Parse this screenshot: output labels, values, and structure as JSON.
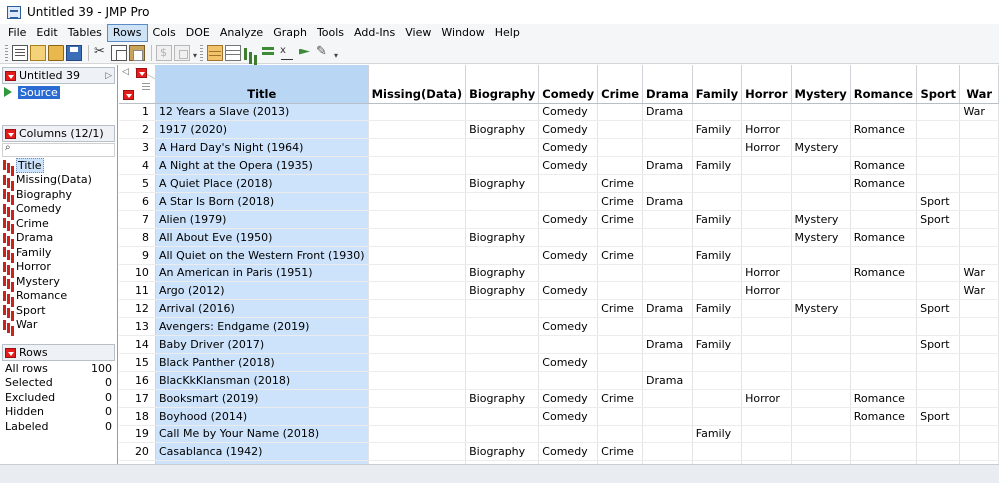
{
  "window": {
    "title": "Untitled 39 - JMP Pro"
  },
  "menu": [
    "File",
    "Edit",
    "Tables",
    "Rows",
    "Cols",
    "DOE",
    "Analyze",
    "Graph",
    "Tools",
    "Add-Ins",
    "View",
    "Window",
    "Help"
  ],
  "menu_active": "Rows",
  "toolbar_icons": [
    "new-data-table-icon",
    "new-script-icon",
    "open-icon",
    "save-icon",
    "cut-icon",
    "copy-icon",
    "paste-icon",
    "disabled-script-icon",
    "disabled-table-icon",
    "data-table-icon",
    "tabulate-icon",
    "distribution-icon",
    "graph-builder-icon",
    "fit-y-by-x-icon",
    "fit-model-icon",
    "edit-script-icon"
  ],
  "left_panel": {
    "table_name": "Untitled 39",
    "source_label": "Source",
    "columns_header": "Columns (12/1)",
    "columns": [
      "Title",
      "Missing(Data)",
      "Biography",
      "Comedy",
      "Crime",
      "Drama",
      "Family",
      "Horror",
      "Mystery",
      "Romance",
      "Sport",
      "War"
    ],
    "selected_column": "Title",
    "rows_header": "Rows",
    "rows_stats": [
      {
        "label": "All rows",
        "value": "100"
      },
      {
        "label": "Selected",
        "value": "0"
      },
      {
        "label": "Excluded",
        "value": "0"
      },
      {
        "label": "Hidden",
        "value": "0"
      },
      {
        "label": "Labeled",
        "value": "0"
      }
    ]
  },
  "grid": {
    "headers": [
      "Title",
      "Missing(Data)",
      "Biography",
      "Comedy",
      "Crime",
      "Drama",
      "Family",
      "Horror",
      "Mystery",
      "Romance",
      "Sport",
      "War"
    ],
    "rows": [
      [
        "1",
        "12 Years a Slave (2013)",
        "",
        "",
        "Comedy",
        "",
        "Drama",
        "",
        "",
        "",
        "",
        "",
        "War"
      ],
      [
        "2",
        "1917 (2020)",
        "",
        "Biography",
        "Comedy",
        "",
        "",
        "Family",
        "Horror",
        "",
        "Romance",
        "",
        ""
      ],
      [
        "3",
        "A Hard Day's Night (1964)",
        "",
        "",
        "Comedy",
        "",
        "",
        "",
        "Horror",
        "Mystery",
        "",
        "",
        ""
      ],
      [
        "4",
        "A Night at the Opera (1935)",
        "",
        "",
        "Comedy",
        "",
        "Drama",
        "Family",
        "",
        "",
        "Romance",
        "",
        ""
      ],
      [
        "5",
        "A Quiet Place (2018)",
        "",
        "Biography",
        "",
        "Crime",
        "",
        "",
        "",
        "",
        "Romance",
        "",
        ""
      ],
      [
        "6",
        "A Star Is Born (2018)",
        "",
        "",
        "",
        "Crime",
        "Drama",
        "",
        "",
        "",
        "",
        "Sport",
        ""
      ],
      [
        "7",
        "Alien (1979)",
        "",
        "",
        "Comedy",
        "Crime",
        "",
        "Family",
        "",
        "Mystery",
        "",
        "Sport",
        ""
      ],
      [
        "8",
        "All About Eve (1950)",
        "",
        "Biography",
        "",
        "",
        "",
        "",
        "",
        "Mystery",
        "Romance",
        "",
        ""
      ],
      [
        "9",
        "All Quiet on the Western Front (1930)",
        "",
        "",
        "Comedy",
        "Crime",
        "",
        "Family",
        "",
        "",
        "",
        "",
        ""
      ],
      [
        "10",
        "An American in Paris (1951)",
        "",
        "Biography",
        "",
        "",
        "",
        "",
        "Horror",
        "",
        "Romance",
        "",
        "War"
      ],
      [
        "11",
        "Argo (2012)",
        "",
        "Biography",
        "Comedy",
        "",
        "",
        "",
        "Horror",
        "",
        "",
        "",
        "War"
      ],
      [
        "12",
        "Arrival (2016)",
        "",
        "",
        "",
        "Crime",
        "Drama",
        "Family",
        "",
        "Mystery",
        "",
        "Sport",
        ""
      ],
      [
        "13",
        "Avengers: Endgame (2019)",
        "",
        "",
        "Comedy",
        "",
        "",
        "",
        "",
        "",
        "",
        "",
        ""
      ],
      [
        "14",
        "Baby Driver (2017)",
        "",
        "",
        "",
        "",
        "Drama",
        "Family",
        "",
        "",
        "",
        "Sport",
        ""
      ],
      [
        "15",
        "Black Panther (2018)",
        "",
        "",
        "Comedy",
        "",
        "",
        "",
        "",
        "",
        "",
        "",
        ""
      ],
      [
        "16",
        "BlacKkKlansman (2018)",
        "",
        "",
        "",
        "",
        "Drama",
        "",
        "",
        "",
        "",
        "",
        ""
      ],
      [
        "17",
        "Booksmart (2019)",
        "",
        "Biography",
        "Comedy",
        "Crime",
        "",
        "",
        "Horror",
        "",
        "Romance",
        "",
        ""
      ],
      [
        "18",
        "Boyhood (2014)",
        "",
        "",
        "Comedy",
        "",
        "",
        "",
        "",
        "",
        "Romance",
        "Sport",
        ""
      ],
      [
        "19",
        "Call Me by Your Name (2018)",
        "",
        "",
        "",
        "",
        "",
        "Family",
        "",
        "",
        "",
        "",
        ""
      ],
      [
        "20",
        "Casablanca (1942)",
        "",
        "Biography",
        "Comedy",
        "Crime",
        "",
        "",
        "",
        "",
        "",
        "",
        ""
      ],
      [
        "21",
        "",
        "",
        "",
        "",
        "",
        "",
        "",
        "",
        "",
        "",
        "",
        ""
      ]
    ]
  }
}
